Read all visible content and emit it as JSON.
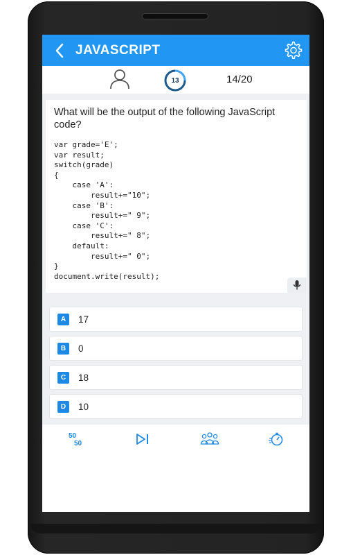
{
  "header": {
    "title": "JAVASCRIPT",
    "back_icon": "chevron-left-icon",
    "settings_icon": "gear-icon",
    "color": "#2196f3"
  },
  "status": {
    "avatar_icon": "user-icon",
    "timer_value": "13",
    "progress": "14/20"
  },
  "question": {
    "text": "What will be the output of the following JavaScript code?",
    "code": "var grade='E';\nvar result;\nswitch(grade)\n{\n    case 'A':\n        result+=\"10\";\n    case 'B':\n        result+=\" 9\";\n    case 'C':\n        result+=\" 8\";\n    default:\n        result+=\" 0\";\n}\ndocument.write(result);",
    "mic_icon": "microphone-icon"
  },
  "options": [
    {
      "letter": "A",
      "text": "17"
    },
    {
      "letter": "B",
      "text": "0"
    },
    {
      "letter": "C",
      "text": "18"
    },
    {
      "letter": "D",
      "text": "10"
    }
  ],
  "lifelines": {
    "fifty_fifty": "50 50",
    "skip_icon": "skip-icon",
    "audience_icon": "audience-icon",
    "timer_icon": "stopwatch-icon"
  }
}
